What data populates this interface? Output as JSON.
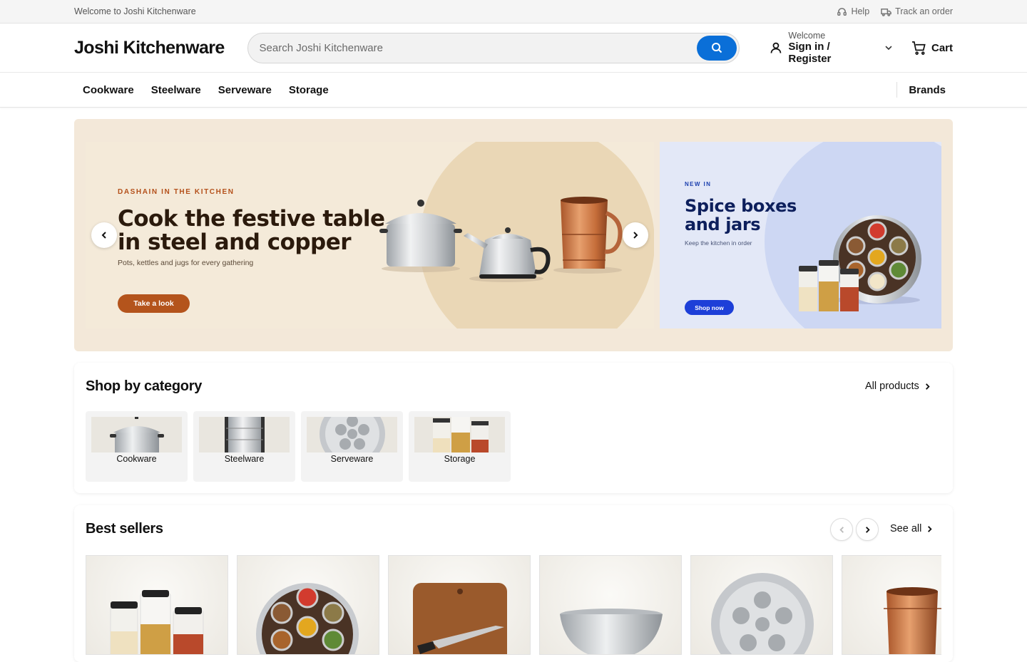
{
  "topbar": {
    "welcome": "Welcome to Joshi Kitchenware",
    "help": "Help",
    "track": "Track an order"
  },
  "header": {
    "logo": "Joshi Kitchenware",
    "search_placeholder": "Search Joshi Kitchenware",
    "account_small": "Welcome",
    "account_big": "Sign in / Register",
    "cart": "Cart"
  },
  "nav": {
    "items": [
      "Cookware",
      "Steelware",
      "Serveware",
      "Storage"
    ],
    "brands": "Brands"
  },
  "hero": {
    "eyebrow": "DASHAIN IN THE KITCHEN",
    "title": "Cook the festive table in steel and copper",
    "subtitle": "Pots, kettles and jugs for every gathering",
    "cta": "Take a look",
    "side_eyebrow": "NEW IN",
    "side_title": "Spice boxes and jars",
    "side_subtitle": "Keep the kitchen in order",
    "side_cta": "Shop now",
    "active_slide": 1,
    "slide_count": 3
  },
  "categories": {
    "title": "Shop by category",
    "link": "All products",
    "items": [
      "Cookware",
      "Steelware",
      "Serveware",
      "Storage"
    ]
  },
  "bestsellers": {
    "title": "Best sellers",
    "link": "See all"
  },
  "colors": {
    "accent": "#0a6fd8",
    "hero_cta": "#b4541c",
    "side_cta": "#1d3fd8"
  }
}
